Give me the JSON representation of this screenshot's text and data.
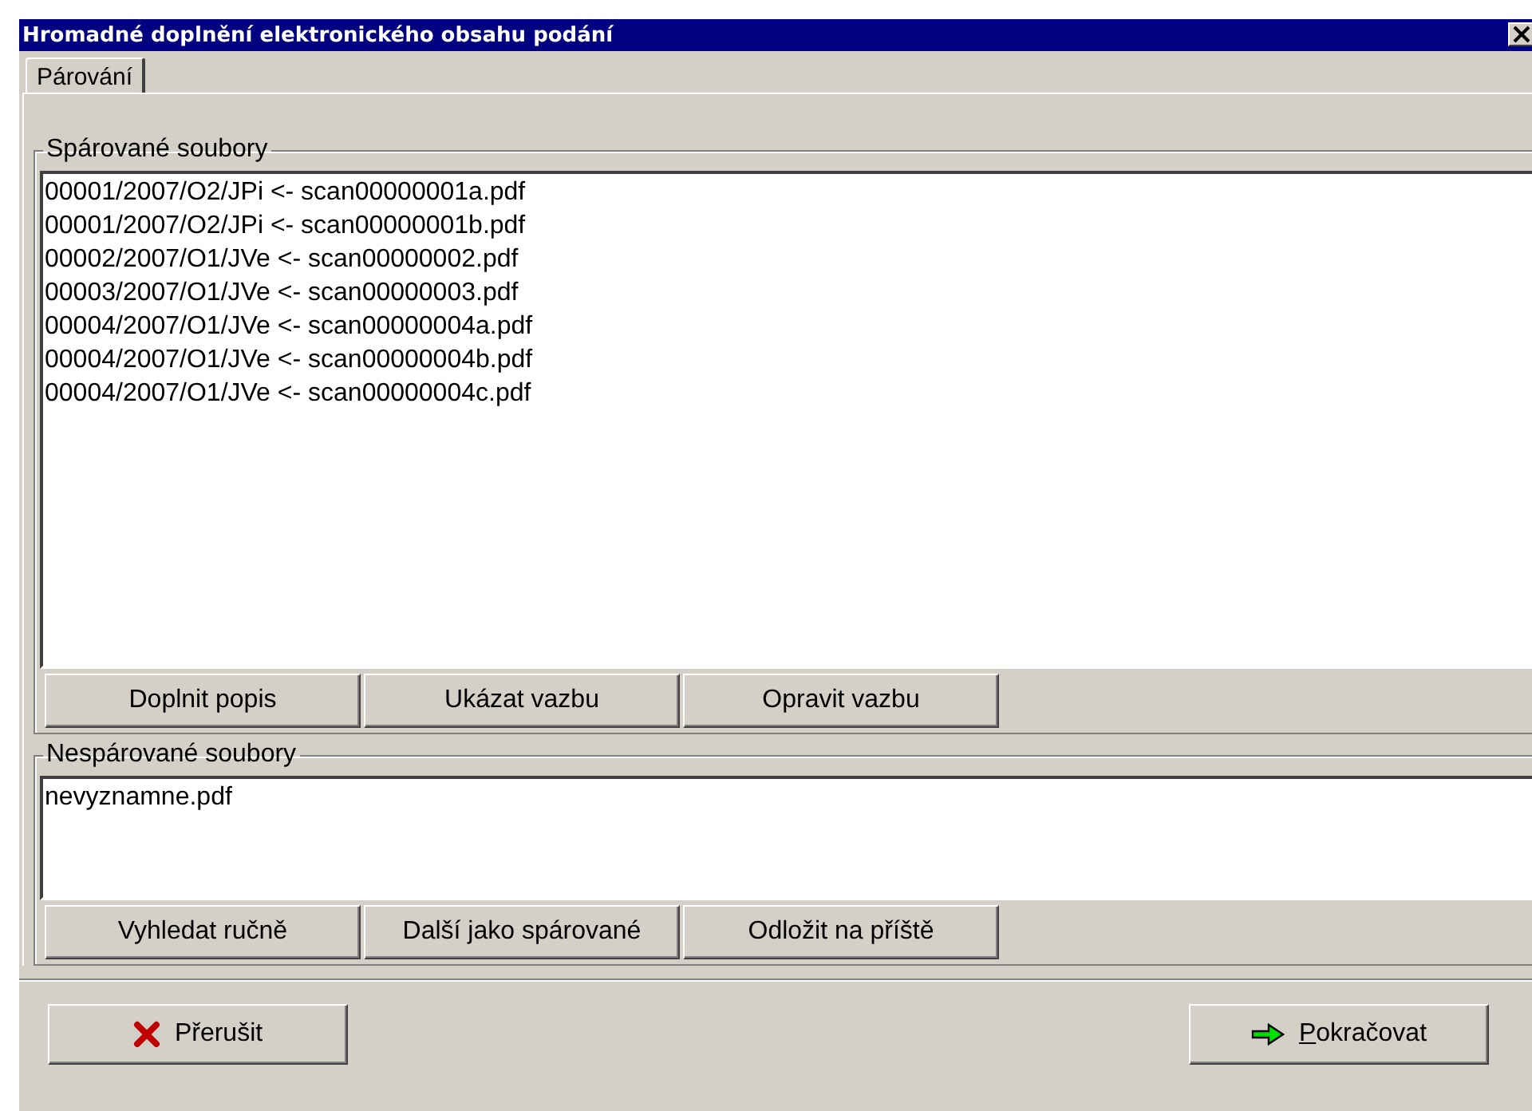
{
  "window": {
    "title": "Hromadné doplnění elektronického obsahu podání"
  },
  "tabs": [
    {
      "label": "Párování",
      "selected": true
    }
  ],
  "paired": {
    "legend": "Spárované soubory",
    "items": [
      "00001/2007/O2/JPi <- scan00000001a.pdf",
      "00001/2007/O2/JPi <- scan00000001b.pdf",
      "00002/2007/O1/JVe <- scan00000002.pdf",
      "00003/2007/O1/JVe <- scan00000003.pdf",
      "00004/2007/O1/JVe <- scan00000004a.pdf",
      "00004/2007/O1/JVe <- scan00000004b.pdf",
      "00004/2007/O1/JVe <- scan00000004c.pdf"
    ],
    "buttons": [
      "Doplnit popis",
      "Ukázat vazbu",
      "Opravit vazbu"
    ]
  },
  "unpaired": {
    "legend": "Nespárované soubory",
    "items": [
      "nevyznamne.pdf"
    ],
    "buttons": [
      "Vyhledat ručně",
      "Další jako spárované",
      "Odložit na příště"
    ]
  },
  "footer_buttons": [
    {
      "label": "Přerušit",
      "kind": "cancel",
      "mnemonic": false
    },
    {
      "label": "Pokračovat",
      "kind": "continue",
      "mnemonic": true
    }
  ]
}
